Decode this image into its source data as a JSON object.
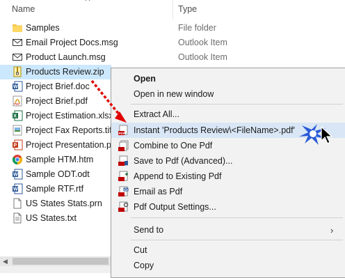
{
  "header": {
    "name": "Name",
    "type": "Type"
  },
  "files": [
    {
      "name": "Samples",
      "type": "File folder",
      "icon": "folder-icon"
    },
    {
      "name": "Email Project Docs.msg",
      "type": "Outlook Item",
      "icon": "mail-icon"
    },
    {
      "name": "Product Launch.msg",
      "type": "Outlook Item",
      "icon": "mail-icon"
    },
    {
      "name": "Products Review.zip",
      "type": "",
      "icon": "zip-icon",
      "selected": true
    },
    {
      "name": "Project Brief.doc",
      "type": "",
      "icon": "word-icon"
    },
    {
      "name": "Project Brief.pdf",
      "type": "",
      "icon": "pdf-icon"
    },
    {
      "name": "Project Estimation.xlsx",
      "type": "",
      "icon": "excel-icon"
    },
    {
      "name": "Project Fax Reports.tif",
      "type": "",
      "icon": "tif-icon"
    },
    {
      "name": "Project Presentation.pp",
      "type": "",
      "icon": "ppt-icon"
    },
    {
      "name": "Sample HTM.htm",
      "type": "",
      "icon": "chrome-icon"
    },
    {
      "name": "Sample ODT.odt",
      "type": "",
      "icon": "word-icon"
    },
    {
      "name": "Sample RTF.rtf",
      "type": "",
      "icon": "word-icon"
    },
    {
      "name": "US States Stats.prn",
      "type": "",
      "icon": "text-icon"
    },
    {
      "name": "US States.txt",
      "type": "",
      "icon": "text-icon"
    }
  ],
  "menu": {
    "open": "Open",
    "open_new_window": "Open in new window",
    "extract_all": "Extract All...",
    "instant": "Instant 'Products Review\\<FileName>.pdf'",
    "combine": "Combine to One Pdf",
    "save_to_pdf": "Save to Pdf (Advanced)...",
    "append": "Append to Existing Pdf",
    "email_pdf": "Email as Pdf",
    "output_settings": "Pdf Output Settings...",
    "send_to": "Send to",
    "cut": "Cut",
    "copy": "Copy"
  },
  "colors": {
    "selection": "#cce8ff",
    "menu_hover": "#d9e6f5",
    "arrow": "#e00000",
    "accent_red": "#c00000"
  }
}
